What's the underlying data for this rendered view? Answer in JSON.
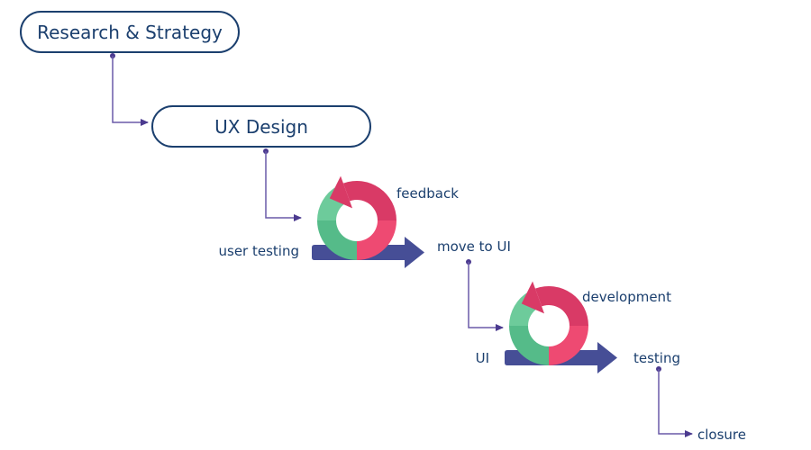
{
  "colors": {
    "text": "#1b3f6e",
    "pill_stroke": "#1b3f6e",
    "connector": "#4b3a8f",
    "bar": "#464e96",
    "green_light": "#6dcb9b",
    "green_dark": "#55bb89",
    "pink_dark": "#d93a66",
    "pink_light": "#ee4a72"
  },
  "stages": [
    {
      "id": "research",
      "label": "Research & Strategy"
    },
    {
      "id": "ux",
      "label": "UX Design"
    }
  ],
  "loops": [
    {
      "id": "ux-loop",
      "input_label": "user testing",
      "loop_label": "feedback",
      "output_label": "move to UI"
    },
    {
      "id": "ui-loop",
      "input_label": "UI",
      "loop_label": "development",
      "output_label": "testing"
    }
  ],
  "final": {
    "label": "closure"
  }
}
